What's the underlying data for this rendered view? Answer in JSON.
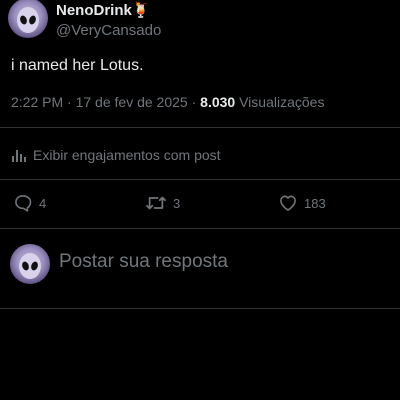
{
  "author": {
    "display_name": "NenoDrink",
    "emoji": "🍹",
    "handle": "@VeryCansado"
  },
  "tweet": {
    "text": "i named her Lotus.",
    "time": "2:22 PM",
    "separator": " · ",
    "date": "17 de fev de 2025",
    "views_count": "8.030",
    "views_label": "Visualizações"
  },
  "engagements_link": "Exibir engajamentos com post",
  "actions": {
    "replies": "4",
    "reposts": "3",
    "likes": "183"
  },
  "reply_box": {
    "placeholder": "Postar sua resposta"
  },
  "icons": {
    "avatar": "alien-avatar",
    "analytics": "bar-chart-icon",
    "reply": "speech-bubble-icon",
    "repost": "repost-arrows-icon",
    "like": "heart-icon"
  },
  "colors": {
    "background": "#000000",
    "primary_text": "#e7e9ea",
    "secondary_text": "#71767b",
    "divider": "#2f3336"
  }
}
